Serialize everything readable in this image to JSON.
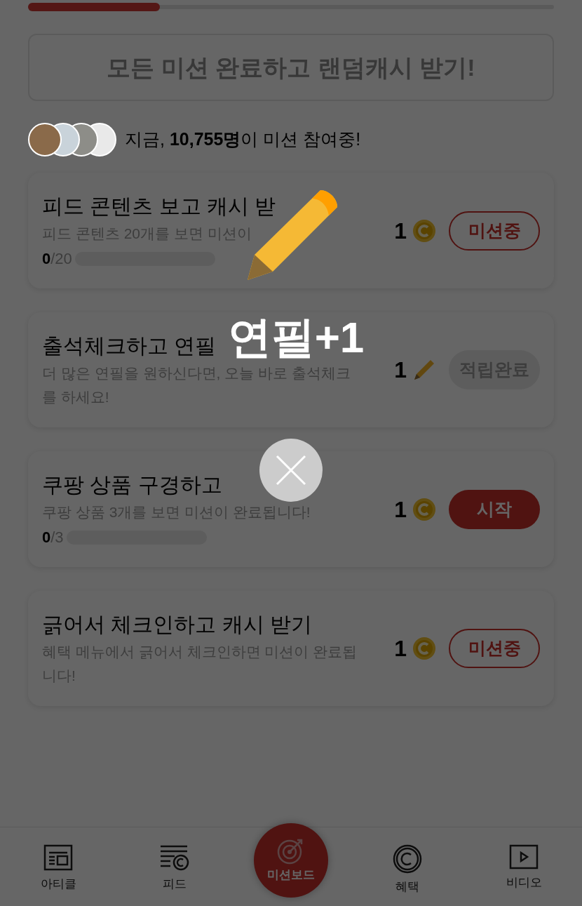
{
  "progress": {
    "level": 0.25
  },
  "banner": {
    "text": "모든 미션 완료하고 랜덤캐시 받기!"
  },
  "participants": {
    "avatars": [
      {
        "kind": "photo"
      },
      {
        "kind": "photo"
      },
      {
        "kind": "photo"
      },
      {
        "kind": "silhouette"
      }
    ],
    "text": "지금, **10,755명**이 미션 참여중!"
  },
  "missions": [
    {
      "title": "피드 콘텐츠 보고 캐시 받",
      "description": "피드 콘텐츠 20개를 보면 미션이",
      "progress": {
        "current": "0",
        "total": "/20",
        "level": 0
      },
      "reward": {
        "amount": "1",
        "kind": "coin"
      },
      "button": {
        "label": "미션중",
        "kind": "outline"
      }
    },
    {
      "title": "출석체크하고 연필",
      "description": "더 많은 연필을 원하신다면, 오늘 바로 출석체크를 하세요!",
      "reward": {
        "amount": "1",
        "kind": "pencil"
      },
      "button": {
        "label": "적립완료",
        "kind": "done"
      }
    },
    {
      "title": "쿠팡 상품 구경하고",
      "description": "쿠팡 상품 3개를 보면 미션이 완료됩니다!",
      "progress": {
        "current": "0",
        "total": "/3",
        "level": 0
      },
      "reward": {
        "amount": "1",
        "kind": "coin"
      },
      "button": {
        "label": "시작",
        "kind": "filled"
      }
    },
    {
      "title": "긁어서 체크인하고 캐시 받기",
      "description": "혜택 메뉴에서 긁어서 체크인하면 미션이 완료됩니다!",
      "reward": {
        "amount": "1",
        "kind": "coin"
      },
      "button": {
        "label": "미션중",
        "kind": "outline"
      }
    }
  ],
  "bottom_nav": [
    {
      "label": "아티클",
      "kind": "article",
      "selected": false
    },
    {
      "label": "피드",
      "kind": "feed",
      "selected": false
    },
    {
      "label": "미션보드",
      "kind": "mission",
      "selected": true
    },
    {
      "label": "혜택",
      "kind": "benefit",
      "selected": false
    },
    {
      "label": "비디오",
      "kind": "video",
      "selected": false
    }
  ],
  "popup": {
    "text": "연필+1"
  }
}
